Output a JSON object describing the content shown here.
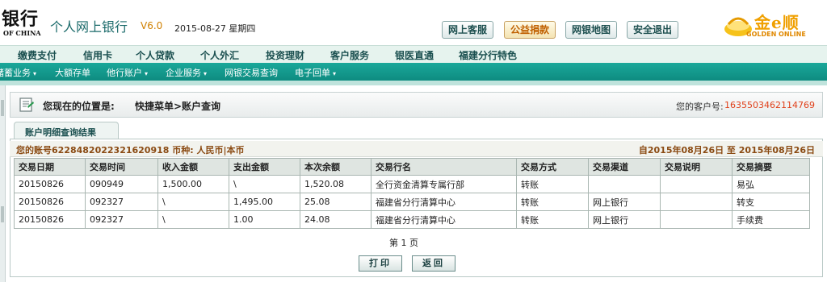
{
  "header": {
    "brand_cn": "银行",
    "brand_en": "OF CHINA",
    "app_title": "个人网上银行",
    "version": "V6.0",
    "date": "2015-08-27 星期四",
    "buttons": [
      "网上客服",
      "公益捐款",
      "网银地图",
      "安全退出"
    ],
    "logo_text": "金e顺",
    "logo_sub": "GOLDEN ONLINE"
  },
  "nav": {
    "main": [
      "缴费支付",
      "信用卡",
      "个人贷款",
      "个人外汇",
      "投资理财",
      "客户服务",
      "银医直通",
      "福建分行特色"
    ],
    "sub": [
      "储蓄业务",
      "大额存单",
      "他行账户",
      "企业服务",
      "网银交易查询",
      "电子回单"
    ],
    "caret": "▾"
  },
  "location": {
    "label": "您现在的位置是:",
    "value": "快捷菜单>账户查询",
    "customer_label": "您的客户号:",
    "customer_no": "1635503462114769"
  },
  "result": {
    "tab_label": "账户明细查询结果",
    "account_info": "您的账号6228482022321620918 币种: 人民币|本币",
    "range": "自2015年08月26日 至 2015年08月26日",
    "columns": [
      "交易日期",
      "交易时间",
      "收入金额",
      "支出金额",
      "本次余额",
      "交易行名",
      "交易方式",
      "交易渠道",
      "交易说明",
      "交易摘要"
    ],
    "rows": [
      [
        "20150826",
        "090949",
        "1,500.00",
        "\\",
        "1,520.08",
        "全行资金清算专属行部",
        "转账",
        "",
        "",
        "易弘"
      ],
      [
        "20150826",
        "092327",
        "\\",
        "1,495.00",
        "25.08",
        "福建省分行清算中心",
        "转账",
        "网上银行",
        "",
        "转支"
      ],
      [
        "20150826",
        "092327",
        "\\",
        "1.00",
        "24.08",
        "福建省分行清算中心",
        "转账",
        "网上银行",
        "",
        "手续费"
      ]
    ],
    "page_info": "第 1 页",
    "print_label": "打印",
    "back_label": "返回"
  }
}
